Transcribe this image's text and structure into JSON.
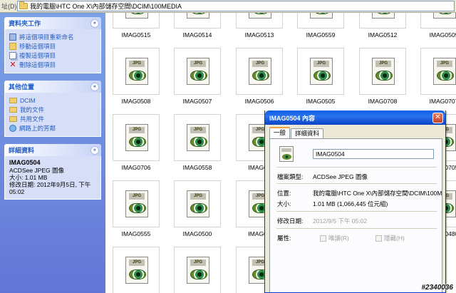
{
  "address": {
    "label": "址(D)",
    "path": "我的電腦\\HTC One X\\內部儲存空間\\DCIM\\100MEDIA"
  },
  "taskpane": {
    "file_tasks": {
      "title": "資料夾工作",
      "items": [
        "將這個項目重新命名",
        "移動這個項目",
        "複製這個項目",
        "刪除這個項目"
      ]
    },
    "other_places": {
      "title": "其他位置",
      "items": [
        "DCIM",
        "我的文件",
        "共用文件",
        "網路上的芳鄰"
      ]
    },
    "details": {
      "title": "詳細資料",
      "name": "IMAG0504",
      "type": "ACDSee JPEG 圖像",
      "size": "大小: 1.01 MB",
      "modified": "修改日期: 2012年9月5日, 下午 05:02"
    },
    "collapse_glyph": "«"
  },
  "thumbnails": {
    "tag": "JPG",
    "row0": [
      "IMAG0515",
      "IMAG0514",
      "IMAG0513",
      "IMAG0559",
      "IMAG0512",
      "IMAG0509"
    ],
    "row1": [
      "IMAG0508",
      "IMAG0507",
      "IMAG0506",
      "IMAG0505",
      "IMAG0708",
      "IMAG0707"
    ],
    "row2": [
      "IMAG0706",
      "IMAG0558",
      "IMAG05",
      "IMAG0705"
    ],
    "row3": [
      "IMAG0555",
      "IMAG0500",
      "IMAG04",
      "IMAG0480"
    ]
  },
  "dialog": {
    "title": "IMAG0504 內容",
    "close_glyph": "✕",
    "tabs": [
      "一般",
      "詳細資料"
    ],
    "filename": "IMAG0504",
    "props": {
      "type_label": "檔案類型:",
      "type_value": "ACDSee JPEG 圖像",
      "location_label": "位置:",
      "location_value": "我的電腦\\HTC One X\\內部儲存空間\\DCIM\\100M",
      "size_label": "大小:",
      "size_value": "1.01 MB (1,066,445 位元組)",
      "modified_label": "修改日期:",
      "modified_value": "2012/9/5 下午 05:02",
      "attr_label": "屬性:",
      "readonly": "唯讀(R)",
      "hidden": "隱藏(H)"
    }
  },
  "watermark": "#2340036"
}
